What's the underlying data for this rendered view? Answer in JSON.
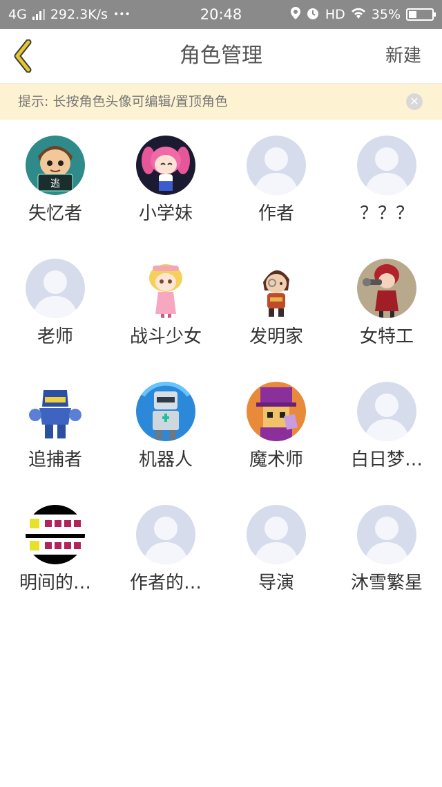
{
  "status_bar": {
    "network": "4G",
    "speed": "292.3K/s",
    "dots": "•••",
    "time": "20:48",
    "hd": "HD",
    "battery": "35%",
    "battery_level": 0.35
  },
  "header": {
    "title": "角色管理",
    "new_label": "新建",
    "back_icon": "chevron-left-icon"
  },
  "tip": {
    "text": "提示: 长按角色头像可编辑/置顶角色",
    "close_icon": "close-icon"
  },
  "colors": {
    "accent_yellow": "#e6c72e",
    "tip_bg": "#fdf3d3",
    "placeholder_bg": "#d6dcec",
    "placeholder_fg": "#f4f6fb"
  },
  "characters": [
    {
      "name": "失忆者",
      "avatar": "escapee"
    },
    {
      "name": "小学妹",
      "avatar": "pink-girl"
    },
    {
      "name": "作者",
      "avatar": "placeholder"
    },
    {
      "name": "？？？",
      "avatar": "placeholder"
    },
    {
      "name": "老师",
      "avatar": "placeholder"
    },
    {
      "name": "战斗少女",
      "avatar": "battle-girl"
    },
    {
      "name": "发明家",
      "avatar": "inventor"
    },
    {
      "name": "女特工",
      "avatar": "agent"
    },
    {
      "name": "追捕者",
      "avatar": "robot-hunter"
    },
    {
      "name": "机器人",
      "avatar": "robot"
    },
    {
      "name": "魔术师",
      "avatar": "magician"
    },
    {
      "name": "白日梦…",
      "avatar": "placeholder"
    },
    {
      "name": "明间的…",
      "avatar": "pattern"
    },
    {
      "name": "作者的…",
      "avatar": "placeholder"
    },
    {
      "name": "导演",
      "avatar": "placeholder"
    },
    {
      "name": "沐雪繁星",
      "avatar": "placeholder"
    }
  ]
}
